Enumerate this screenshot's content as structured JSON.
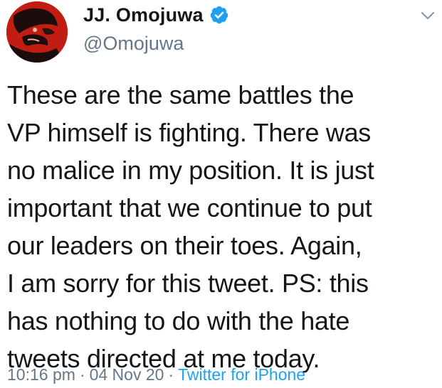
{
  "author": {
    "display_name": "JJ. Omojuwa",
    "handle": "@Omojuwa",
    "verified_icon": "verified-badge-icon"
  },
  "tweet": {
    "text": "These are the same battles the\nVP himself is fighting. There was\nno malice in my position. It is just\nimportant that we continue to put\nour leaders on their toes. Again,\nI am sorry for this tweet. PS: this\nhas nothing to do with the hate\ntweets directed at me today."
  },
  "meta": {
    "time": "10:16 pm",
    "separator": "·",
    "date": "04 Nov 20",
    "source": "Twitter for iPhone"
  },
  "colors": {
    "primary_text": "#14171a",
    "secondary_text": "#657786",
    "link": "#1da1f2",
    "avatar_bg": "#c21d12"
  },
  "icons": {
    "menu": "chevron-down-icon"
  }
}
